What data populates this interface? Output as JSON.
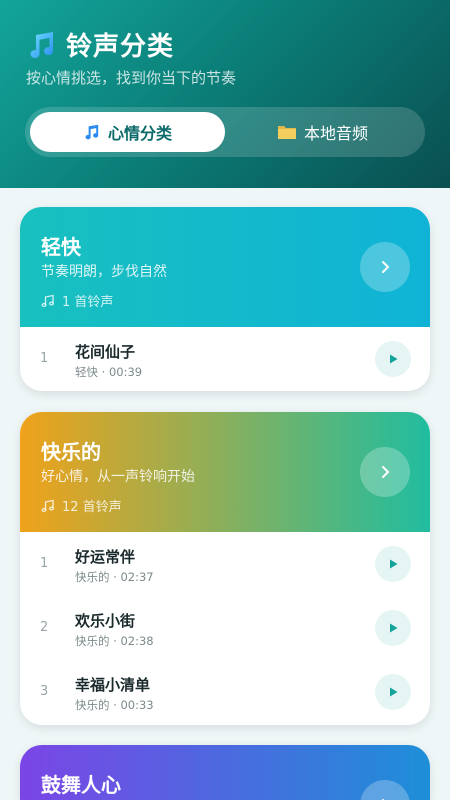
{
  "header": {
    "title": "铃声分类",
    "subtitle": "按心情挑选，找到你当下的节奏",
    "title_icon": "music-note-icon"
  },
  "tabs": [
    {
      "label": "心情分类",
      "icon": "music-note-icon",
      "active": true
    },
    {
      "label": "本地音频",
      "icon": "folder-icon",
      "active": false
    }
  ],
  "categories": [
    {
      "name": "轻快",
      "description": "节奏明朗，步伐自然",
      "count": "1 首铃声",
      "gradient": [
        "#18c0bf",
        "#10b3d6"
      ],
      "songs": [
        {
          "index": "1",
          "title": "花间仙子",
          "meta": "轻快 · 00:39"
        }
      ]
    },
    {
      "name": "快乐的",
      "description": "好心情，从一声铃响开始",
      "count": "12 首铃声",
      "gradient": [
        "#f0a21a",
        "#20bda0"
      ],
      "songs": [
        {
          "index": "1",
          "title": "好运常伴",
          "meta": "快乐的 · 02:37"
        },
        {
          "index": "2",
          "title": "欢乐小街",
          "meta": "快乐的 · 02:38"
        },
        {
          "index": "3",
          "title": "幸福小清单",
          "meta": "快乐的 · 00:33"
        }
      ]
    },
    {
      "name": "鼓舞人心",
      "gradient": [
        "#7b45e6",
        "#1d8fd8"
      ]
    }
  ],
  "colors": {
    "accent": "#0c6b6a",
    "play_icon": "#14a39a"
  }
}
